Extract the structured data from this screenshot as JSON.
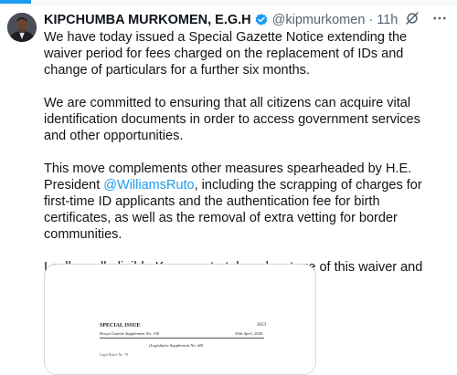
{
  "author": {
    "name": "KIPCHUMBA MURKOMEN, E.G.H",
    "handle": "@kipmurkomen",
    "separator": "·",
    "time": "11h",
    "verified": true,
    "avatar_icon": "profile-photo"
  },
  "header_icons": [
    "grok-icon",
    "more-options-icon"
  ],
  "tweet": {
    "paragraphs": [
      {
        "text": "We have today issued a Special Gazette Notice extending the waiver period for fees charged on the replacement of IDs and change of particulars for a further six months."
      },
      {
        "text": "We are committed to ensuring that all citizens can acquire vital identification documents in order to access government services and other opportunities."
      },
      {
        "before": "This move complements other measures spearheaded by H.E. President ",
        "mention": "@WilliamsRuto",
        "after": ", including the scrapping of charges for first-time ID applicants and the authentication fee for birth certificates, as well as the removal of extra vetting for border communities."
      },
      {
        "text": "I call on all eligible Kenyans to take advantage of this waiver and register for ID cards."
      }
    ]
  },
  "media": {
    "doc_title": "SPECIAL ISSUE",
    "doc_page": "2653",
    "doc_supplement": "Kenya Gazette Supplement No. 100",
    "doc_date": "30th April, 2026",
    "doc_legislative": "(Legislative Supplement No. 68)",
    "doc_notice": "Legal Notice No. 78"
  },
  "colors": {
    "link": "#1d9bf0",
    "verified_badge": "#1d9bf0",
    "muted_text": "#536471",
    "text": "#0f1419",
    "card_border": "#cfd9de"
  }
}
